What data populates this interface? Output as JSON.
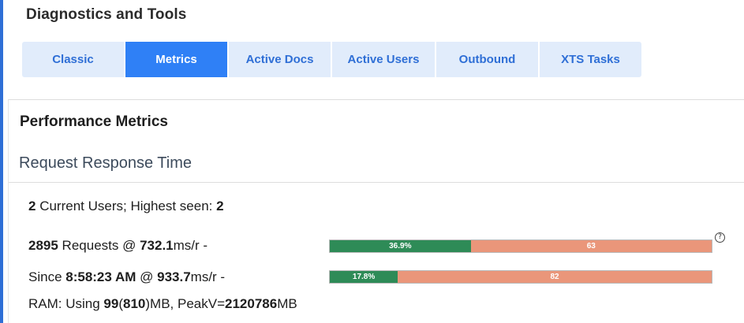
{
  "page": {
    "title": "Diagnostics and Tools"
  },
  "tabs": [
    {
      "label": "Classic",
      "active": false
    },
    {
      "label": "Metrics",
      "active": true
    },
    {
      "label": "Active Docs",
      "active": false
    },
    {
      "label": "Active Users",
      "active": false
    },
    {
      "label": "Outbound",
      "active": false
    },
    {
      "label": "XTS Tasks",
      "active": false
    }
  ],
  "panel": {
    "heading": "Performance Metrics",
    "section_heading": "Request Response Time"
  },
  "users": {
    "current": "2",
    "current_label": " Current Users; Highest seen: ",
    "highest": "2"
  },
  "requests": {
    "count": "2895",
    "label": " Requests @ ",
    "rate": "732.1",
    "unit": "ms/r -",
    "bar": {
      "green_pct": 36.9,
      "green_label": "36.9%",
      "orange_label": "63"
    }
  },
  "since": {
    "prefix": "Since ",
    "time": "8:58:23 AM",
    "mid": " @ ",
    "rate": "933.7",
    "unit": "ms/r -",
    "bar": {
      "green_pct": 17.8,
      "green_label": "17.8%",
      "orange_label": "82"
    }
  },
  "ram": {
    "prefix": "RAM: Using ",
    "used": "99",
    "open_paren": "(",
    "total": "810",
    "mid": ")MB, PeakV=",
    "peak": "2120786",
    "unit": "MB"
  },
  "help": {
    "symbol": "?"
  },
  "colors": {
    "accent": "#2f80f6",
    "tab_bg": "#e1ecfb",
    "bar_green": "#2e8b57",
    "bar_orange": "#ea967a"
  }
}
